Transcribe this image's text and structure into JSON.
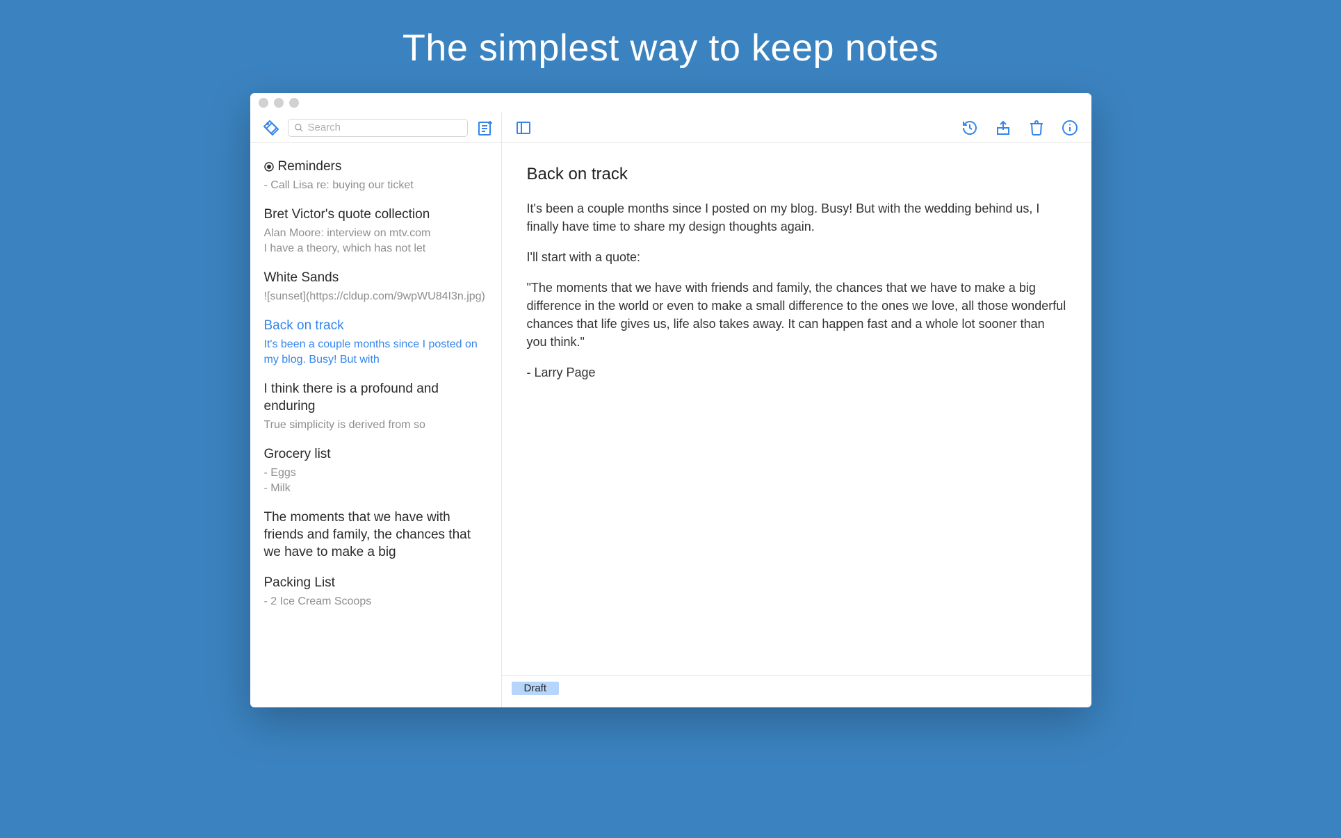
{
  "hero": {
    "title": "The simplest way to keep notes"
  },
  "search": {
    "placeholder": "Search"
  },
  "notes": [
    {
      "title": "Reminders",
      "preview": "- Call Lisa re: buying our ticket",
      "pinned": true,
      "selected": false
    },
    {
      "title": "Bret Victor's quote collection",
      "preview": "Alan Moore: interview on mtv.com\nI have a theory, which has not let",
      "pinned": false,
      "selected": false
    },
    {
      "title": "White Sands",
      "preview": "![sunset](https://cldup.com/9wpWU84I3n.jpg)",
      "pinned": false,
      "selected": false
    },
    {
      "title": "Back on track",
      "preview": "It's been a couple months since I posted on my blog. Busy! But with",
      "pinned": false,
      "selected": true
    },
    {
      "title": "I think there is a profound and enduring",
      "preview": "True simplicity is derived from so",
      "pinned": false,
      "selected": false
    },
    {
      "title": "Grocery list",
      "preview": "- Eggs\n- Milk",
      "pinned": false,
      "selected": false
    },
    {
      "title": "The moments that we have with friends and family, the chances that we have to make a big",
      "preview": "",
      "pinned": false,
      "selected": false
    },
    {
      "title": "Packing List",
      "preview": "- 2 Ice Cream Scoops",
      "pinned": false,
      "selected": false
    }
  ],
  "editor": {
    "title": "Back on track",
    "paragraphs": [
      "It's been a couple months since I posted on my blog. Busy! But with the wedding behind us, I finally have time to share my design thoughts again.",
      "I'll start with a quote:",
      "\"The moments that we have with friends and family, the chances that we have to make a big difference in the world or even to make a small difference to the ones we love, all those wonderful chances that life gives us, life also takes away. It can happen fast and a whole lot sooner than you think.\"",
      "- Larry Page"
    ],
    "tag": "Draft"
  }
}
